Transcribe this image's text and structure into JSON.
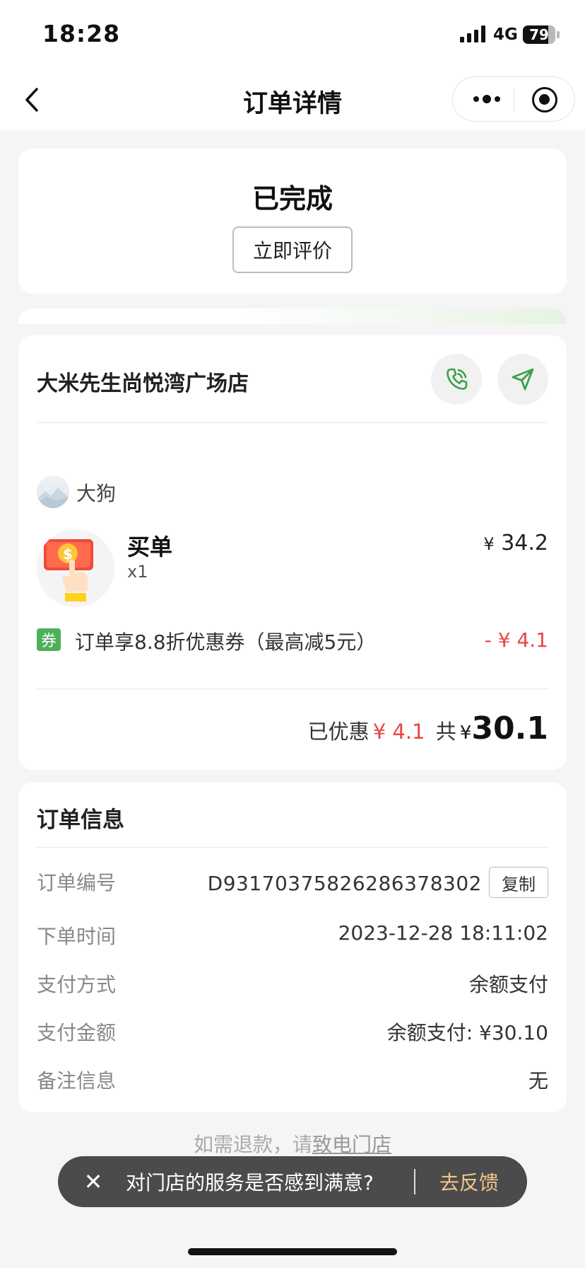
{
  "status_bar": {
    "time": "18:28",
    "network": "4G",
    "battery": "79",
    "battery_level": 0.79
  },
  "nav": {
    "title": "订单详情",
    "back_icon": "chevron-left-icon",
    "more_icon": "more-dots-icon",
    "close_icon": "target-circle-icon"
  },
  "order_status": {
    "status": "已完成",
    "review_button": "立即评价"
  },
  "store": {
    "name": "大米先生尚悦湾广场店",
    "phone_icon": "phone-icon",
    "navigate_icon": "navigation-arrow-icon"
  },
  "user": {
    "name": "大狗"
  },
  "product": {
    "name": "买单",
    "quantity": "x1",
    "price_symbol": "¥",
    "price": "34.2"
  },
  "coupon": {
    "tag": "券",
    "description": "订单享8.8折优惠券（最高减5元）",
    "amount": "- ¥ 4.1"
  },
  "summary": {
    "discount_label": "已优惠",
    "discount_amount": "¥ 4.1",
    "total_label": "共",
    "total_symbol": "¥",
    "total": "30.1"
  },
  "order_info": {
    "title": "订单信息",
    "order_no_label": "订单编号",
    "order_no": "D93170375826286378302",
    "copy_button": "复制",
    "rows": [
      {
        "label": "下单时间",
        "value": "2023-12-28 18:11:02"
      },
      {
        "label": "支付方式",
        "value": "余额支付"
      },
      {
        "label": "支付金额",
        "value": "余额支付: ¥30.10"
      },
      {
        "label": "备注信息",
        "value": "无"
      }
    ]
  },
  "refund": {
    "prefix": "如需退款，请",
    "link": "致电门店"
  },
  "feedback": {
    "close_symbol": "✕",
    "question": "对门店的服务是否感到满意?",
    "action": "去反馈"
  },
  "colors": {
    "accent_green": "#4cb05a",
    "discount_red": "#e84545",
    "feedback_action": "#f2c58a"
  }
}
